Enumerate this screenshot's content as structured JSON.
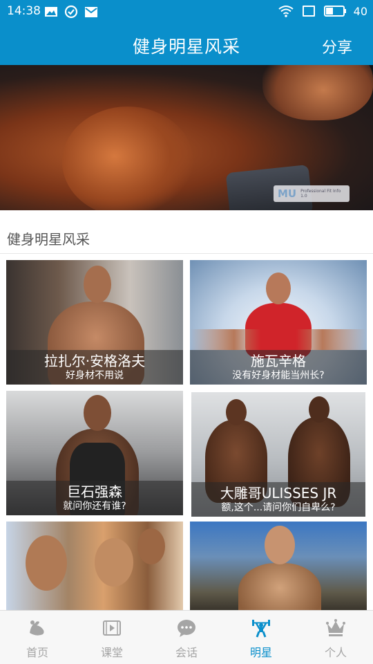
{
  "status_bar": {
    "time": "14:38",
    "battery": "40"
  },
  "header": {
    "title": "健身明星风采",
    "share_label": "分享"
  },
  "section": {
    "title": "健身明星风采"
  },
  "cards": [
    {
      "name": "拉扎尔·安格洛夫",
      "subtitle": "好身材不用说"
    },
    {
      "name": "施瓦辛格",
      "subtitle": "没有好身材能当州长?"
    },
    {
      "name": "巨石强森",
      "subtitle": "就问你还有谁?"
    },
    {
      "name": "大雕哥ULISSES JR",
      "subtitle": "额,这个...请问你们自卑么?"
    },
    {
      "name": "",
      "subtitle": ""
    },
    {
      "name": "",
      "subtitle": ""
    }
  ],
  "tabs": [
    {
      "label": "首页",
      "icon": "muscle-icon"
    },
    {
      "label": "课堂",
      "icon": "video-icon"
    },
    {
      "label": "会话",
      "icon": "chat-icon"
    },
    {
      "label": "明星",
      "icon": "weightlifter-icon"
    },
    {
      "label": "个人",
      "icon": "crown-icon"
    }
  ],
  "active_tab": "明星",
  "colors": {
    "accent": "#0a8fcb",
    "tab_inactive": "#a5a5a5"
  }
}
